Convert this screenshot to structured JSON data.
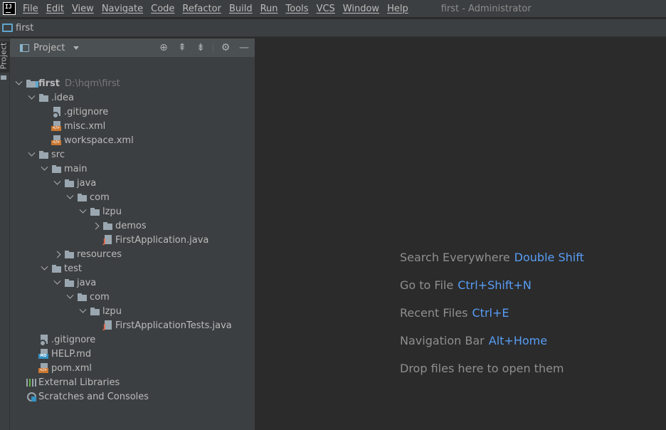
{
  "menubar": {
    "logo_text": "IJ",
    "items": [
      "File",
      "Edit",
      "View",
      "Navigate",
      "Code",
      "Refactor",
      "Build",
      "Run",
      "Tools",
      "VCS",
      "Window",
      "Help"
    ],
    "window_title": "first - Administrator"
  },
  "navbar": {
    "label": "first"
  },
  "toolstrip": {
    "project_tab": "Project"
  },
  "panel": {
    "title": "Project",
    "tree": [
      {
        "label": "first",
        "hint": "D:\\hqm\\first",
        "icon": "module-folder-icon",
        "depth": 0,
        "chevron": "down",
        "bold": true
      },
      {
        "label": ".idea",
        "icon": "folder-icon",
        "depth": 1,
        "chevron": "down"
      },
      {
        "label": ".gitignore",
        "icon": "gitignore-icon",
        "depth": 2,
        "chevron": "none"
      },
      {
        "label": "misc.xml",
        "icon": "xml-file-icon",
        "depth": 2,
        "chevron": "none"
      },
      {
        "label": "workspace.xml",
        "icon": "xml-file-icon",
        "depth": 2,
        "chevron": "none"
      },
      {
        "label": "src",
        "icon": "folder-icon",
        "depth": 1,
        "chevron": "down"
      },
      {
        "label": "main",
        "icon": "folder-icon",
        "depth": 2,
        "chevron": "down"
      },
      {
        "label": "java",
        "icon": "folder-icon",
        "depth": 3,
        "chevron": "down"
      },
      {
        "label": "com",
        "icon": "folder-icon",
        "depth": 4,
        "chevron": "down"
      },
      {
        "label": "lzpu",
        "icon": "folder-icon",
        "depth": 5,
        "chevron": "down"
      },
      {
        "label": "demos",
        "icon": "folder-icon",
        "depth": 6,
        "chevron": "right"
      },
      {
        "label": "FirstApplication.java",
        "icon": "java-file-icon",
        "depth": 6,
        "chevron": "none"
      },
      {
        "label": "resources",
        "icon": "folder-icon",
        "depth": 3,
        "chevron": "right"
      },
      {
        "label": "test",
        "icon": "folder-icon",
        "depth": 2,
        "chevron": "down"
      },
      {
        "label": "java",
        "icon": "folder-icon",
        "depth": 3,
        "chevron": "down"
      },
      {
        "label": "com",
        "icon": "folder-icon",
        "depth": 4,
        "chevron": "down"
      },
      {
        "label": "lzpu",
        "icon": "folder-icon",
        "depth": 5,
        "chevron": "down"
      },
      {
        "label": "FirstApplicationTests.java",
        "icon": "java-file-icon",
        "depth": 6,
        "chevron": "none"
      },
      {
        "label": ".gitignore",
        "icon": "gitignore-icon",
        "depth": 1,
        "chevron": "none"
      },
      {
        "label": "HELP.md",
        "icon": "md-file-icon",
        "depth": 1,
        "chevron": "none"
      },
      {
        "label": "pom.xml",
        "icon": "xml-file-icon",
        "depth": 1,
        "chevron": "none"
      },
      {
        "label": "External Libraries",
        "icon": "libraries-icon",
        "depth": 0,
        "chevron": "right-hidden"
      },
      {
        "label": "Scratches and Consoles",
        "icon": "scratches-icon",
        "depth": 0,
        "chevron": "right-hidden"
      }
    ]
  },
  "editor": {
    "hints": [
      {
        "text": "Search Everywhere",
        "key": "Double Shift"
      },
      {
        "text": "Go to File",
        "key": "Ctrl+Shift+N"
      },
      {
        "text": "Recent Files",
        "key": "Ctrl+E"
      },
      {
        "text": "Navigation Bar",
        "key": "Alt+Home"
      },
      {
        "text": "Drop files here to open them",
        "key": ""
      }
    ]
  },
  "colors": {
    "background": "#2b2b2b",
    "chrome": "#3c3f41",
    "text": "#bbbbbb",
    "shortcut": "#589df6",
    "xml_badge": "#cc7832",
    "java_badge": "#e4694c"
  }
}
